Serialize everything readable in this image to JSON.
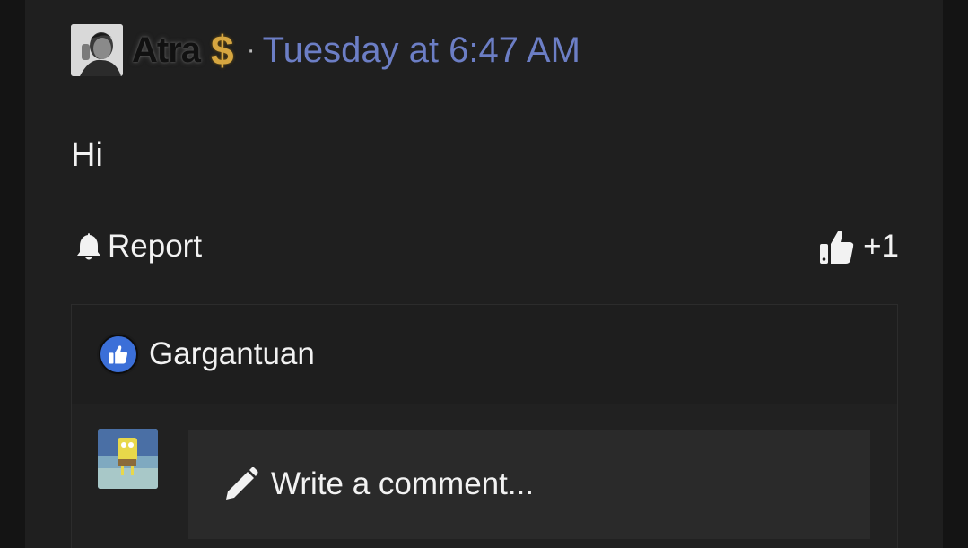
{
  "post": {
    "author": "Atra",
    "badge": "$",
    "separator": "·",
    "timestamp": "Tuesday at 6:47 AM",
    "body": "Hi"
  },
  "actions": {
    "report_label": "Report",
    "like_count": "+1"
  },
  "reactions": {
    "reactor_name": "Gargantuan"
  },
  "comment": {
    "placeholder": "Write a comment..."
  },
  "colors": {
    "timestamp": "#6c7ec5",
    "badge": "#d6a640",
    "like_blue": "#3b6fd8",
    "background": "#1f1f1f"
  },
  "icons": {
    "report": "bell-icon",
    "like": "thumbs-up-icon",
    "comment": "pencil-icon"
  }
}
